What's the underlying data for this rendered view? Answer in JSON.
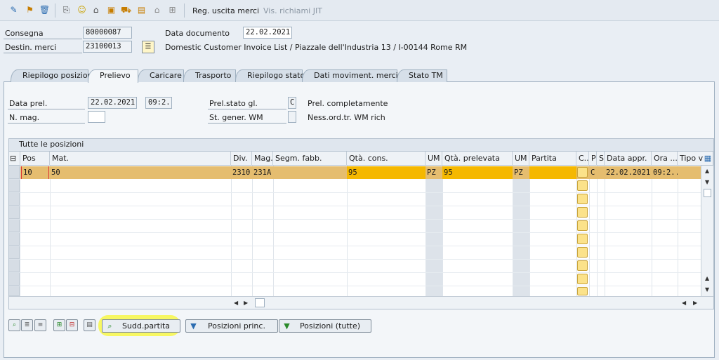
{
  "toolbar": {
    "icons": [
      "pencil-glasses-icon",
      "hand-hold-icon",
      "delete-icon",
      "document-icon",
      "people-icon",
      "hat-icon",
      "box-icon",
      "truck-icon",
      "arrow-icon",
      "grid-icon"
    ],
    "post_goods_issue": "Reg. uscita merci",
    "jit_calls": "Vis. richiami JIT"
  },
  "header": {
    "delivery_label": "Consegna",
    "delivery_value": "80000087",
    "doc_date_label": "Data documento",
    "doc_date_value": "22.02.2021",
    "ship_to_label": "Destin. merci",
    "ship_to_value": "23100013",
    "ship_to_desc": "Domestic Customer Invoice List / Piazzale dell'Industria 13 / I-00144 Rome RM"
  },
  "tabs": [
    {
      "label": "Riepilogo posizioni"
    },
    {
      "label": "Prelievo"
    },
    {
      "label": "Caricare"
    },
    {
      "label": "Trasporto"
    },
    {
      "label": "Riepilogo stato"
    },
    {
      "label": "Dati moviment. merci"
    },
    {
      "label": "Stato TM"
    }
  ],
  "picking": {
    "pick_date_label": "Data prel.",
    "pick_date_value": "22.02.2021",
    "pick_time_value": "09:2...",
    "overall_status_label": "Prel.stato gl.",
    "overall_status_value": "C",
    "overall_status_text": "Prel. completamente",
    "warehouse_label": "N. mag.",
    "warehouse_value": "",
    "wm_status_label": "St. gener. WM",
    "wm_status_value": "",
    "wm_status_text": "Ness.ord.tr. WM rich"
  },
  "grid": {
    "title": "Tutte le posizioni",
    "columns": [
      "Pos",
      "Mat.",
      "Div.",
      "Mag.",
      "Segm. fabb.",
      "Qtà. cons.",
      "UM",
      "Qtà. prelevata",
      "UM",
      "Partita",
      "C...",
      "P",
      "S",
      "Data appr.",
      "Ora ...",
      "Tipo va"
    ],
    "rows": [
      {
        "pos": "10",
        "mat": "50",
        "div": "2310",
        "mag": "231A",
        "segm": "",
        "qty": "95",
        "um": "PZ",
        "picked": "95",
        "um2": "PZ",
        "batch": "",
        "c": "",
        "p": "C",
        "s": "",
        "date": "22.02.2021",
        "time": "09:2...",
        "type": ""
      }
    ]
  },
  "buttons": {
    "batch_split": "Sudd.partita",
    "main_items": "Posizioni princ.",
    "all_items": "Posizioni (tutte)"
  },
  "colors": {
    "selected_row": "#e5bd6f",
    "qty_highlight": "#f5b800",
    "button_highlight": "#f7f75a"
  }
}
